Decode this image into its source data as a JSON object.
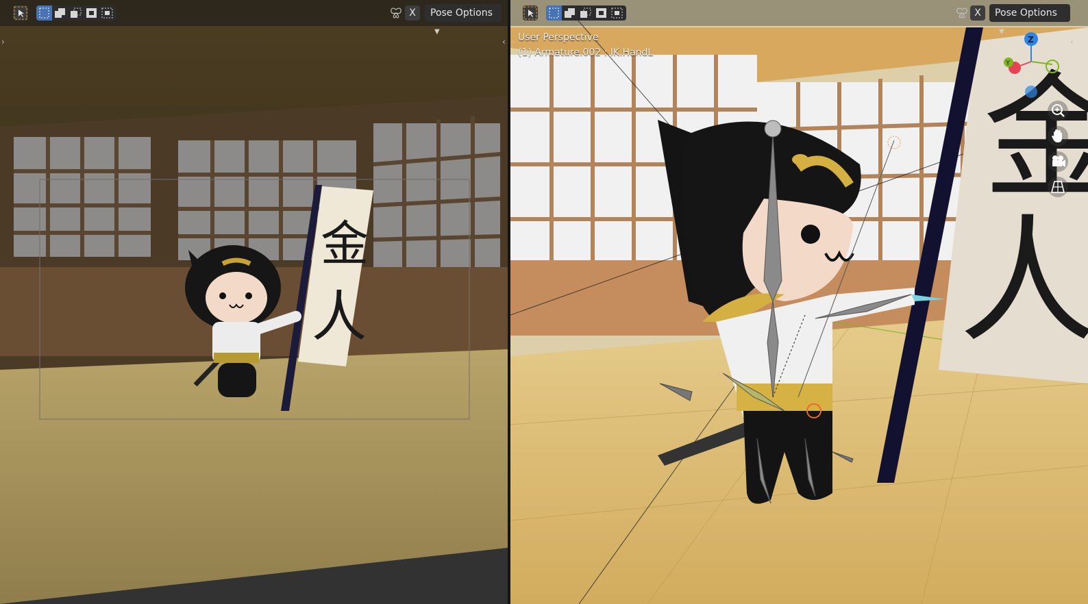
{
  "left_viewport": {
    "header": {
      "tools": [
        "select-tool-icon",
        "select-box-new-icon",
        "select-box-extend-icon",
        "select-box-subtract-icon",
        "select-box-invert-icon",
        "select-box-intersect-icon"
      ],
      "close_label": "X",
      "pose_options_label": "Pose Options"
    },
    "scene": {
      "banner_text_top": "金",
      "banner_text_bottom": "人"
    }
  },
  "right_viewport": {
    "header": {
      "tools": [
        "select-tool-icon",
        "select-box-new-icon",
        "select-box-extend-icon",
        "select-box-subtract-icon",
        "select-box-invert-icon",
        "select-box-intersect-icon"
      ],
      "close_label": "X",
      "pose_options_label": "Pose Options"
    },
    "overlay": {
      "view_name": "User Perspective",
      "active_object": "(1) Armature.002 : IK.HandL"
    },
    "gizmo": {
      "axis_z": "Z",
      "axis_y": "Y",
      "colors": {
        "x": "#e64454",
        "y": "#7fb51e",
        "z": "#2f84e3"
      }
    },
    "nav_buttons": [
      "zoom-icon",
      "pan-hand-icon",
      "camera-icon",
      "perspective-grid-icon"
    ],
    "scene": {
      "banner_text_top": "金",
      "banner_text_bottom": "人"
    }
  },
  "colors": {
    "accent": "#4772b3",
    "select_orange": "#e89a2d",
    "header_bg": "#2b2b2b"
  }
}
